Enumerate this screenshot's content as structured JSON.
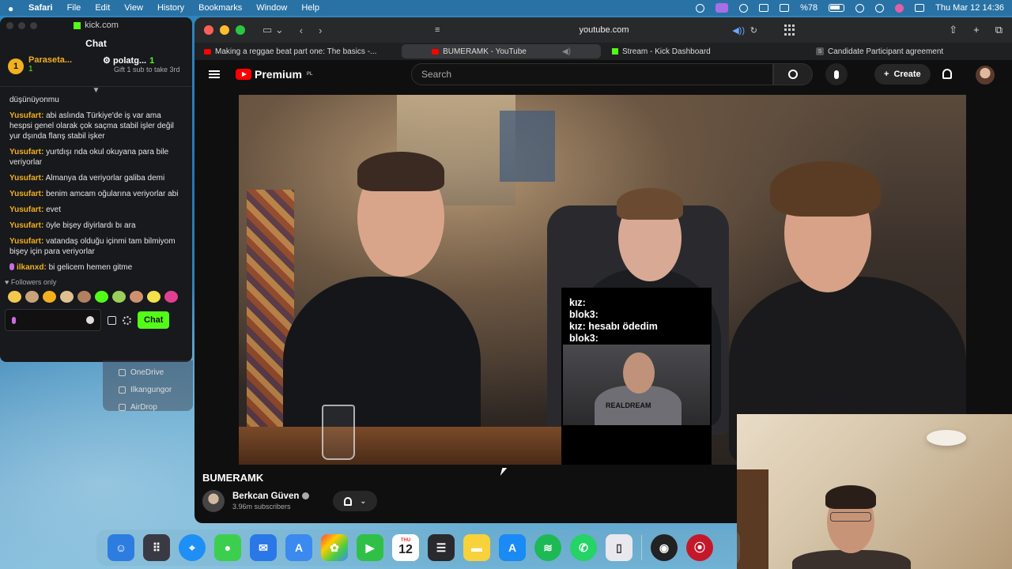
{
  "menubar": {
    "app": "Safari",
    "items": [
      "File",
      "Edit",
      "View",
      "History",
      "Bookmarks",
      "Window",
      "Help"
    ],
    "battery_label": "%78",
    "datetime": "Thu Mar 12  14:36"
  },
  "kick": {
    "window_title": "kick.com",
    "header": "Chat",
    "leader1": {
      "rank": "1",
      "name": "Paraseta...",
      "count": "1"
    },
    "leader2": {
      "name": "polatg...",
      "count": "1",
      "gift": "Gift 1 sub to take 3rd"
    },
    "messages": [
      {
        "user": "",
        "text": "düşünüyonmu"
      },
      {
        "user": "Yusufart:",
        "text": "abi aslında Türkiye'de iş var ama hespsi genel olarak çok saçma stabil işler değil yur dşında flanş stabil işker"
      },
      {
        "user": "Yusufart:",
        "text": "yurtdışı nda okul okuyana para bile veriyorlar"
      },
      {
        "user": "Yusufart:",
        "text": "Almanya da veriyorlar galiba demi"
      },
      {
        "user": "Yusufart:",
        "text": "benim amcam oğularına veriyorlar abi"
      },
      {
        "user": "Yusufart:",
        "text": "evet"
      },
      {
        "user": "Yusufart:",
        "text": "öyle bişey diyirlardı bı ara"
      },
      {
        "user": "Yusufart:",
        "text": "vatandaş olduğu içinmi tam bilmiyom bişey için para veriyorlar"
      }
    ],
    "last_message": {
      "user": "ilkanxd:",
      "text": "bi gelicem hemen gitme"
    },
    "followers_only": "Followers only",
    "chat_button": "Chat"
  },
  "finder": {
    "items": [
      "OneDrive",
      "Ilkangungor",
      "AirDrop"
    ]
  },
  "safari": {
    "address": "youtube.com",
    "tabs": [
      {
        "label": "Making a reggae beat part one: The basics -...",
        "favicon": "youtube"
      },
      {
        "label": "BUMERAMK - YouTube",
        "favicon": "youtube"
      },
      {
        "label": "Stream - Kick Dashboard",
        "favicon": "kick"
      },
      {
        "label": "Candidate Participant agreement",
        "favicon": "S"
      }
    ]
  },
  "youtube": {
    "logo_text": "Premium",
    "region": "PL",
    "search_placeholder": "Search",
    "create_label": "Create",
    "video_title": "BUMERAMK",
    "channel_name": "Berkcan Güven",
    "subscribers": "3.96m subscribers",
    "overlay_lines": [
      "kız:",
      "blok3:",
      "kız: hesabı ödedim",
      "blok3:"
    ],
    "overlay_shirt": "REALDREAM"
  },
  "dock": {
    "calendar_day": "12",
    "calendar_month": "THU"
  }
}
